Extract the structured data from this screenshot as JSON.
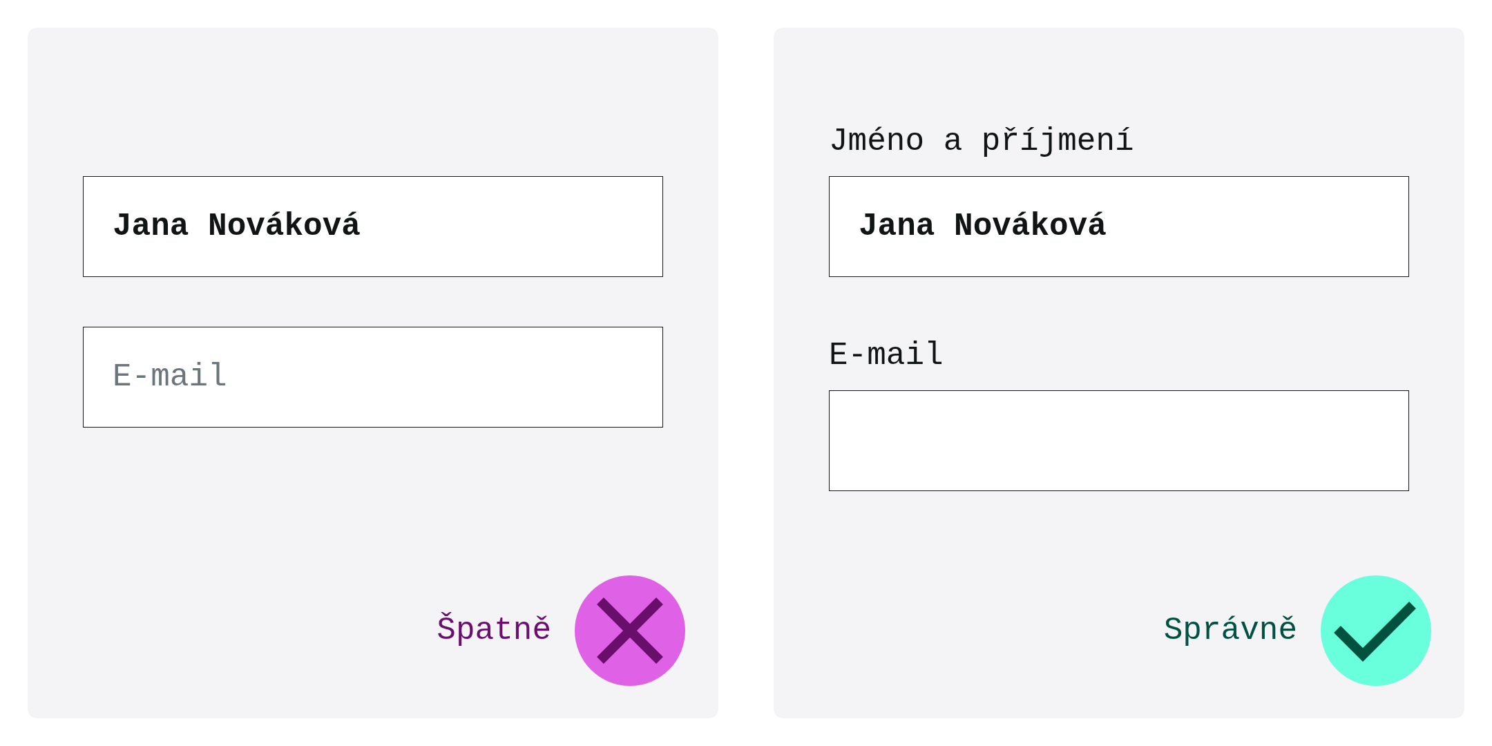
{
  "panels": [
    {
      "kind": "wrong",
      "fields": [
        {
          "value": "Jana Nováková"
        },
        {
          "placeholder": "E-mail"
        }
      ],
      "verdict": "Špatně"
    },
    {
      "kind": "right",
      "fields": [
        {
          "label": "Jméno a příjmení",
          "value": "Jana Nováková"
        },
        {
          "label": "E-mail"
        }
      ],
      "verdict": "Správně"
    }
  ]
}
